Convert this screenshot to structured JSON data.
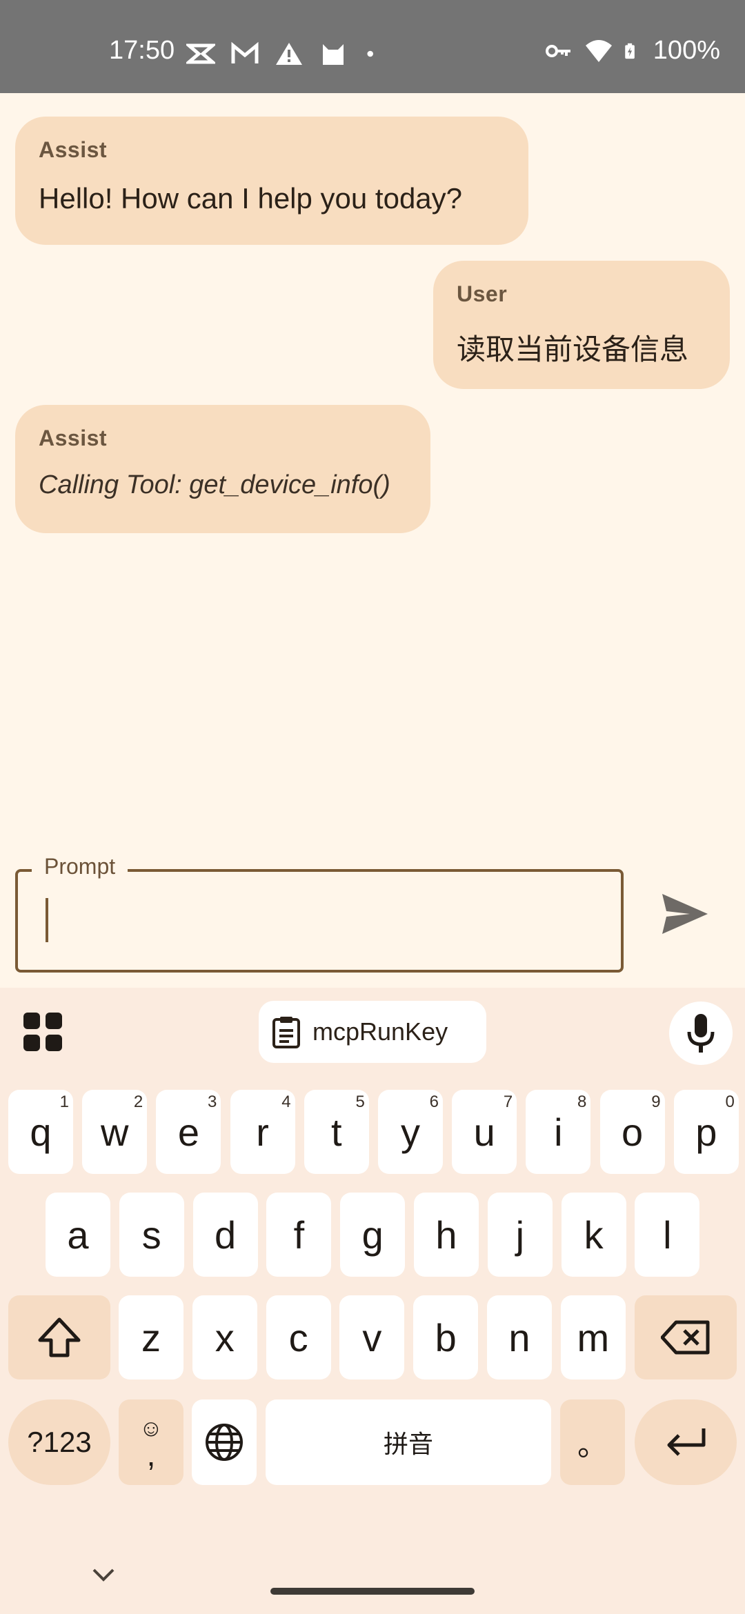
{
  "status_bar": {
    "time": "17:50",
    "battery": "100%",
    "left_icons": [
      "capcut-icon",
      "gmail-icon",
      "warning-icon",
      "cat-icon",
      "dot-icon"
    ],
    "right_icons": [
      "vpn-key-icon",
      "wifi-icon",
      "battery-charging-icon"
    ]
  },
  "chat": {
    "messages": [
      {
        "role": "Assist",
        "text": "Hello! How can I help you today?"
      },
      {
        "role": "User",
        "text": "读取当前设备信息"
      },
      {
        "role": "Assist",
        "text": "Calling Tool: get_device_info()"
      }
    ]
  },
  "input": {
    "label": "Prompt",
    "value": ""
  },
  "keyboard": {
    "clipboard_chip": "mcpRunKey",
    "row1": [
      {
        "k": "q",
        "h": "1"
      },
      {
        "k": "w",
        "h": "2"
      },
      {
        "k": "e",
        "h": "3"
      },
      {
        "k": "r",
        "h": "4"
      },
      {
        "k": "t",
        "h": "5"
      },
      {
        "k": "y",
        "h": "6"
      },
      {
        "k": "u",
        "h": "7"
      },
      {
        "k": "i",
        "h": "8"
      },
      {
        "k": "o",
        "h": "9"
      },
      {
        "k": "p",
        "h": "0"
      }
    ],
    "row2": [
      "a",
      "s",
      "d",
      "f",
      "g",
      "h",
      "j",
      "k",
      "l"
    ],
    "row3": [
      "z",
      "x",
      "c",
      "v",
      "b",
      "n",
      "m"
    ],
    "symbols_key": "?123",
    "emoji_key_char": ",",
    "space_label": "拼音",
    "period_key": "。"
  },
  "colors": {
    "background": "#fff6ea",
    "bubble": "#f8ddc0",
    "accent": "#7a5a35",
    "keyboard_bg": "#fbebdf"
  }
}
